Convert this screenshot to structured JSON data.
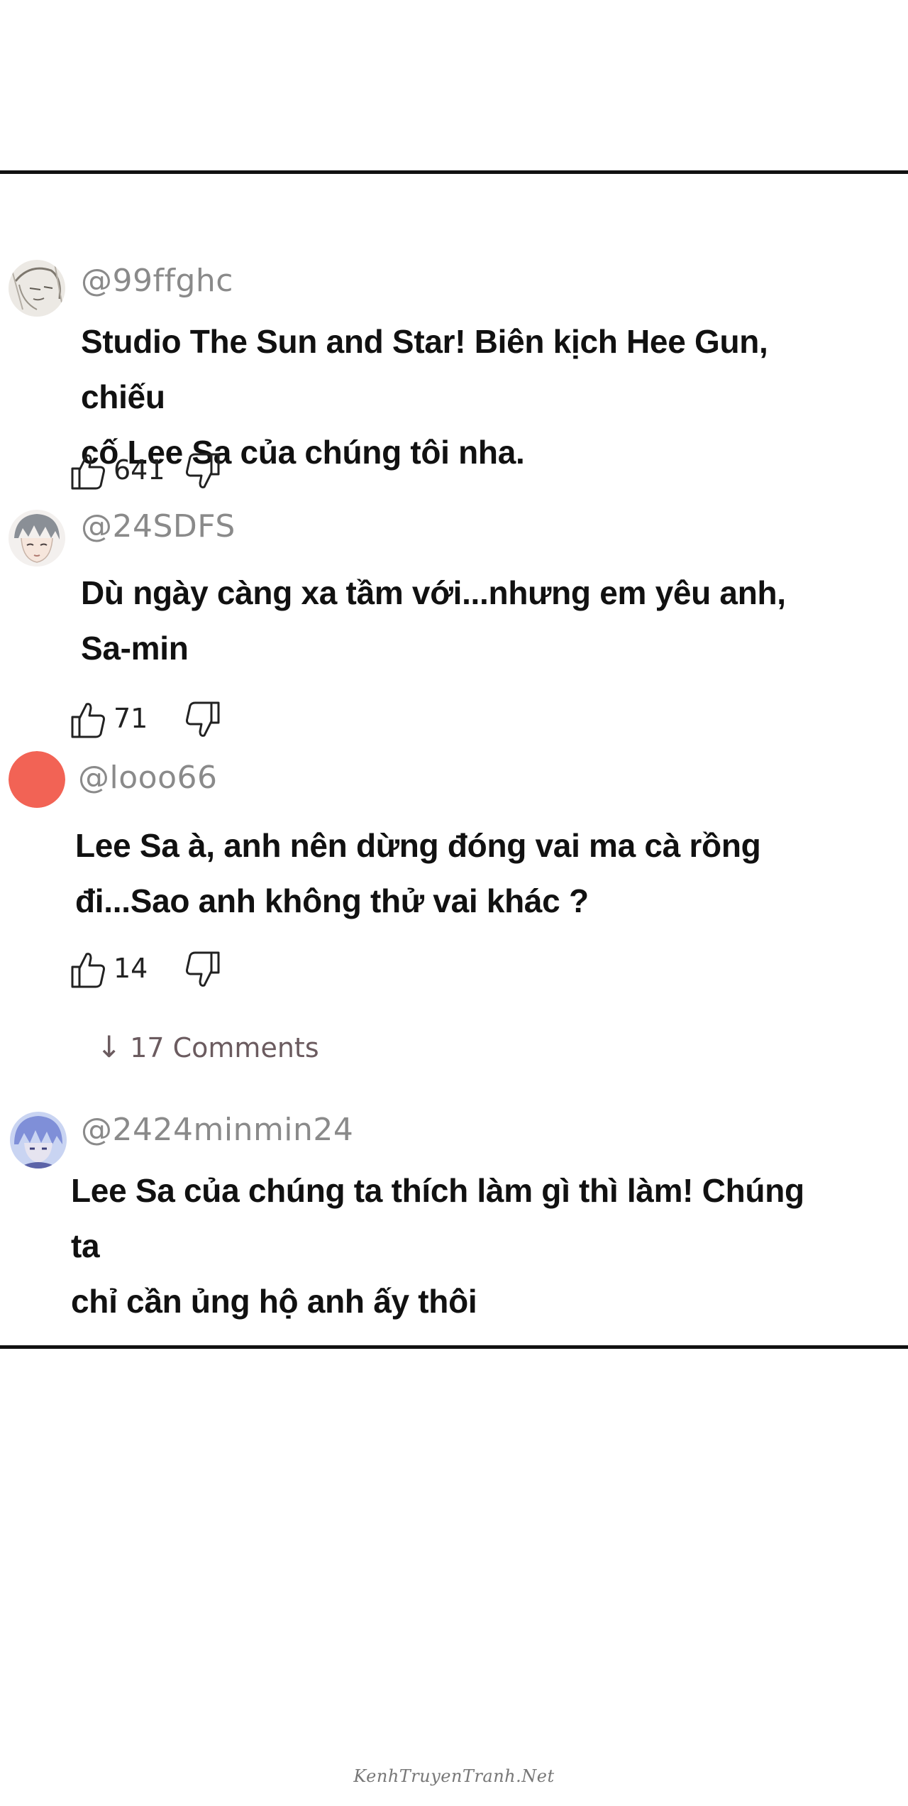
{
  "comments": [
    {
      "username": "@99ffghc",
      "text_lines": [
        "Studio The Sun and Star! Biên kịch Hee Gun, chiếu",
        "cố Lee Sa của chúng tôi nha."
      ],
      "likes": "641",
      "avatar_icon": "sketch-portrait-avatar"
    },
    {
      "username": "@24SDFS",
      "text_lines": [
        "Dù ngày càng xa tầm với...nhưng em yêu anh,",
        "Sa-min"
      ],
      "likes": "71",
      "avatar_icon": "anime-portrait-avatar"
    },
    {
      "username": "@looo66",
      "text_lines": [
        "Lee Sa à, anh nên dừng đóng vai ma cà rồng",
        "đi...Sao anh không thử vai khác ?"
      ],
      "likes": "14",
      "avatar_icon": "red-circle-avatar",
      "avatar_color": "#f26355"
    },
    {
      "username": "@2424minmin24",
      "text_lines": [
        "Lee Sa của chúng ta thích làm gì thì làm! Chúng ta",
        "chỉ cần ủng hộ anh ấy thôi"
      ],
      "likes": "",
      "avatar_icon": "blue-anime-avatar"
    }
  ],
  "more_comments": {
    "arrow": "↓",
    "label": "17 Comments"
  },
  "watermark": "KenhTruyenTranh.Net",
  "colors": {
    "username": "#8a8a8a",
    "text": "#111111",
    "rule": "#111111",
    "more_comments": "#6b5b5f"
  }
}
